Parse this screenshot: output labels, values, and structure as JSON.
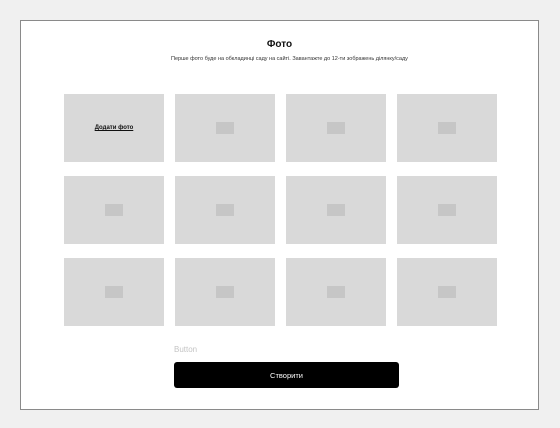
{
  "header": {
    "title": "Фото",
    "subtitle": "Перше фото буде на обкладинці саду на сайті. Завантажте до 12-ти зображень ділянку/саду"
  },
  "gallery": {
    "add_photo_label": "Додати фото",
    "tiles": [
      {
        "type": "add"
      },
      {
        "type": "placeholder",
        "icon": "image-placeholder-icon"
      },
      {
        "type": "placeholder",
        "icon": "image-placeholder-icon"
      },
      {
        "type": "placeholder",
        "icon": "image-placeholder-icon"
      },
      {
        "type": "placeholder",
        "icon": "image-placeholder-icon"
      },
      {
        "type": "placeholder",
        "icon": "image-placeholder-icon"
      },
      {
        "type": "placeholder",
        "icon": "image-placeholder-icon"
      },
      {
        "type": "placeholder",
        "icon": "image-placeholder-icon"
      },
      {
        "type": "placeholder",
        "icon": "image-placeholder-icon"
      },
      {
        "type": "placeholder",
        "icon": "image-placeholder-icon"
      },
      {
        "type": "placeholder",
        "icon": "image-placeholder-icon"
      },
      {
        "type": "placeholder",
        "icon": "image-placeholder-icon"
      }
    ]
  },
  "actions": {
    "button_caption": "Button",
    "create_label": "Створити"
  },
  "colors": {
    "page_background": "#f0f0f0",
    "tile_background": "#d9d9d9",
    "tile_icon": "#c6c6c6",
    "primary_button": "#000000",
    "primary_button_text": "#ffffff",
    "caption_text": "#c4c4c4"
  }
}
